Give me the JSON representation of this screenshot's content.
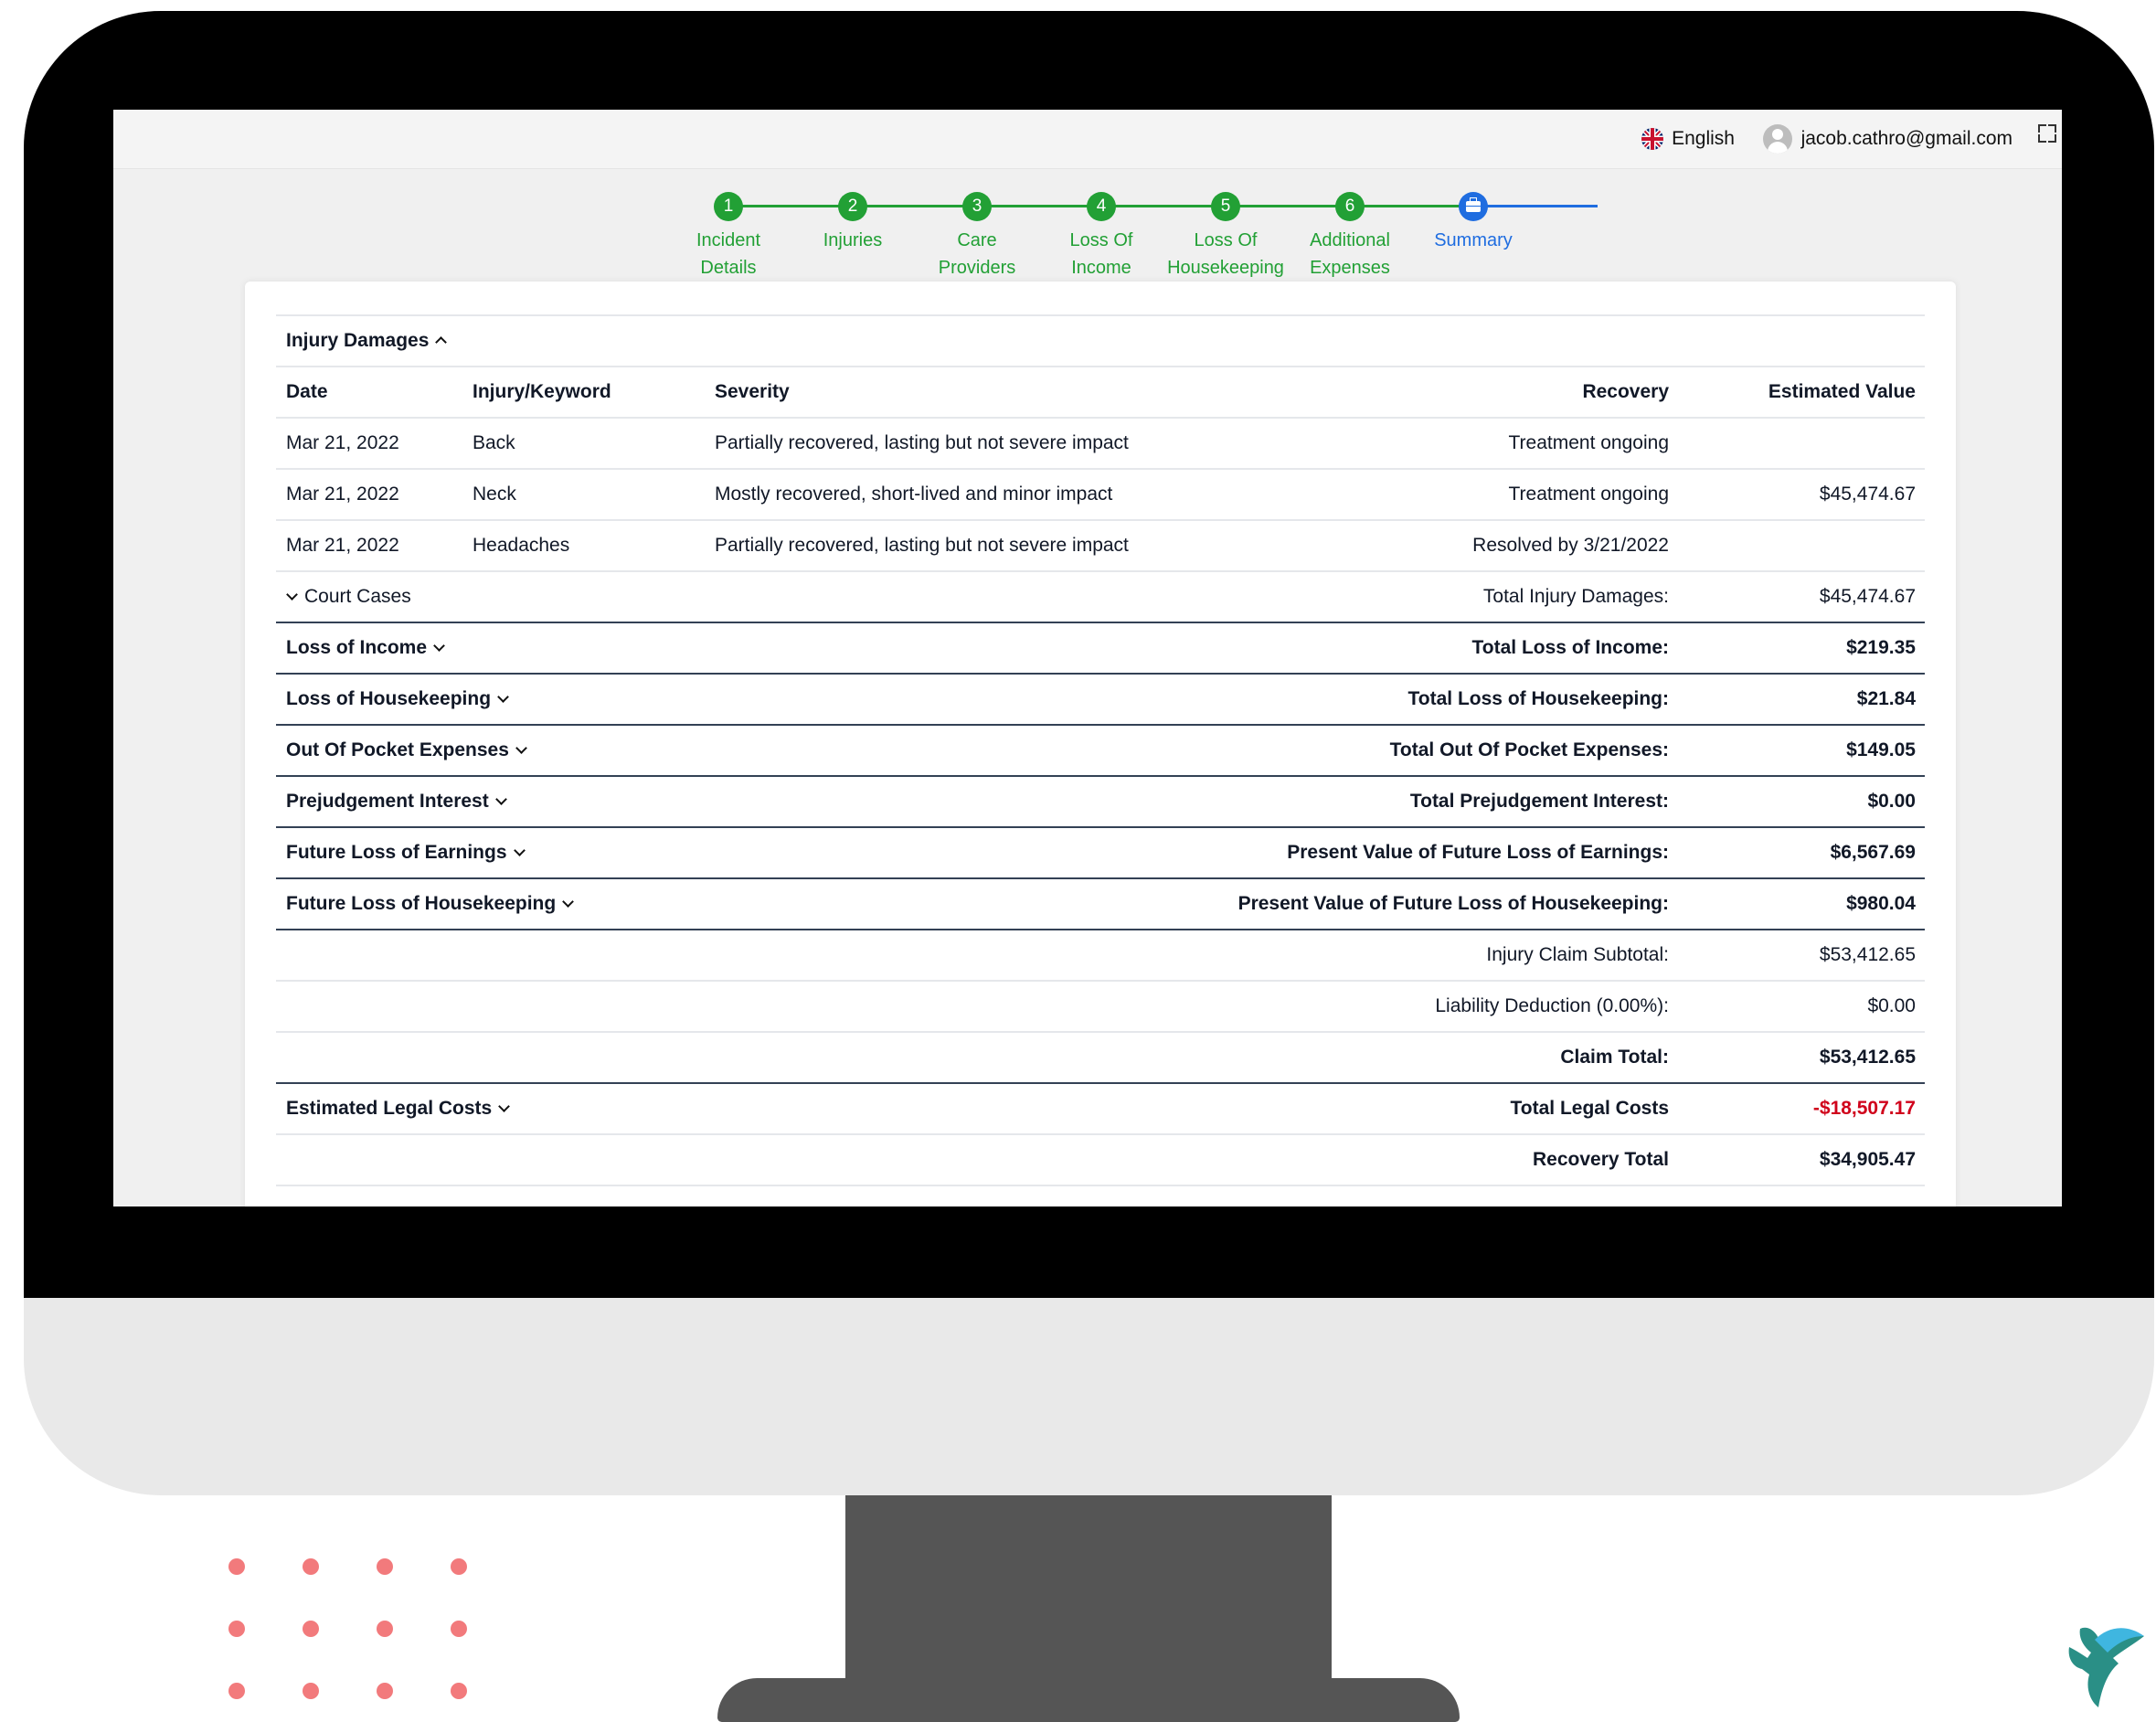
{
  "topbar": {
    "language": "English",
    "language_icon": "uk-flag-icon",
    "user_email": "jacob.cathro@gmail.com"
  },
  "stepper": {
    "steps": [
      {
        "number": "1",
        "label_line1": "Incident",
        "label_line2": "Details",
        "state": "complete"
      },
      {
        "number": "2",
        "label_line1": "Injuries",
        "label_line2": "",
        "state": "complete"
      },
      {
        "number": "3",
        "label_line1": "Care",
        "label_line2": "Providers",
        "state": "complete"
      },
      {
        "number": "4",
        "label_line1": "Loss Of",
        "label_line2": "Income",
        "state": "complete"
      },
      {
        "number": "5",
        "label_line1": "Loss Of",
        "label_line2": "Housekeeping",
        "state": "complete"
      },
      {
        "number": "6",
        "label_line1": "Additional",
        "label_line2": "Expenses",
        "state": "complete"
      },
      {
        "number": "",
        "label_line1": "Summary",
        "label_line2": "",
        "state": "active",
        "icon": "briefcase-icon"
      }
    ],
    "colors": {
      "complete": "#22a035",
      "active": "#1f6de0"
    }
  },
  "summary": {
    "injury_damages": {
      "title": "Injury Damages",
      "columns": [
        "Date",
        "Injury/Keyword",
        "Severity",
        "Recovery",
        "Estimated Value"
      ],
      "rows": [
        {
          "date": "Mar 21, 2022",
          "injury": "Back",
          "severity": "Partially recovered, lasting but not severe impact",
          "recovery": "Treatment ongoing",
          "value": ""
        },
        {
          "date": "Mar 21, 2022",
          "injury": "Neck",
          "severity": "Mostly recovered, short-lived and minor impact",
          "recovery": "Treatment ongoing",
          "value": "$45,474.67"
        },
        {
          "date": "Mar 21, 2022",
          "injury": "Headaches",
          "severity": "Partially recovered, lasting but not severe impact",
          "recovery": "Resolved by 3/21/2022",
          "value": ""
        }
      ],
      "court_cases_label": "Court Cases",
      "total_label": "Total Injury Damages:",
      "total_value": "$45,474.67"
    },
    "sections": [
      {
        "title": "Loss of Income",
        "total_label": "Total Loss of Income:",
        "total_value": "$219.35"
      },
      {
        "title": "Loss of Housekeeping",
        "total_label": "Total Loss of Housekeeping:",
        "total_value": "$21.84"
      },
      {
        "title": "Out Of Pocket Expenses",
        "total_label": "Total Out Of Pocket Expenses:",
        "total_value": "$149.05"
      },
      {
        "title": "Prejudgement Interest",
        "total_label": "Total Prejudgement Interest:",
        "total_value": "$0.00"
      },
      {
        "title": "Future Loss of Earnings",
        "total_label": "Present Value of Future Loss of Earnings:",
        "total_value": "$6,567.69"
      },
      {
        "title": "Future Loss of Housekeeping",
        "total_label": "Present Value of Future Loss of Housekeeping:",
        "total_value": "$980.04"
      }
    ],
    "subtotals": [
      {
        "label": "Injury Claim Subtotal:",
        "value": "$53,412.65"
      },
      {
        "label": "Liability Deduction (0.00%):",
        "value": "$0.00"
      },
      {
        "label": "Claim Total:",
        "value": "$53,412.65"
      }
    ],
    "legal_costs": {
      "title": "Estimated Legal Costs",
      "total_label": "Total Legal Costs",
      "total_value": "-$18,507.17",
      "color": "#d0021b"
    },
    "recovery_total": {
      "label": "Recovery Total",
      "value": "$34,905.47"
    }
  },
  "decor": {
    "dot_color": "#f27a7c",
    "logo_icon": "brand-logo-icon"
  }
}
